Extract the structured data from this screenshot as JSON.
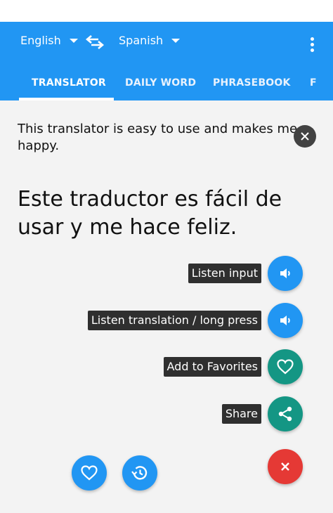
{
  "colors": {
    "primary": "#2196f3",
    "accent_teal": "#149684",
    "close_red": "#e53935",
    "chip_bg": "#2f2f2f"
  },
  "header": {
    "source_language": "English",
    "target_language": "Spanish",
    "swap_icon": "swap-arrows-icon",
    "menu_icon": "more-vert-icon"
  },
  "tabs": [
    {
      "label": "TRANSLATOR",
      "active": true
    },
    {
      "label": "DAILY WORD",
      "active": false
    },
    {
      "label": "PHRASEBOOK",
      "active": false
    },
    {
      "label": "F",
      "active": false
    }
  ],
  "content": {
    "input_text": "This translator is easy to use and makes me happy.",
    "translation_text": "Este traductor es fácil de usar y me hace feliz."
  },
  "fab_menu": {
    "listen_input": {
      "label": "Listen input",
      "icon": "speaker-icon"
    },
    "listen_translation": {
      "label": "Listen translation / long press",
      "icon": "speaker-icon"
    },
    "add_favorites": {
      "label": "Add to Favorites",
      "icon": "heart-outline-icon"
    },
    "share": {
      "label": "Share",
      "icon": "share-icon"
    },
    "close_icon": "close-icon"
  },
  "bottom_bar": {
    "favorites_icon": "heart-outline-icon",
    "history_icon": "history-icon"
  }
}
